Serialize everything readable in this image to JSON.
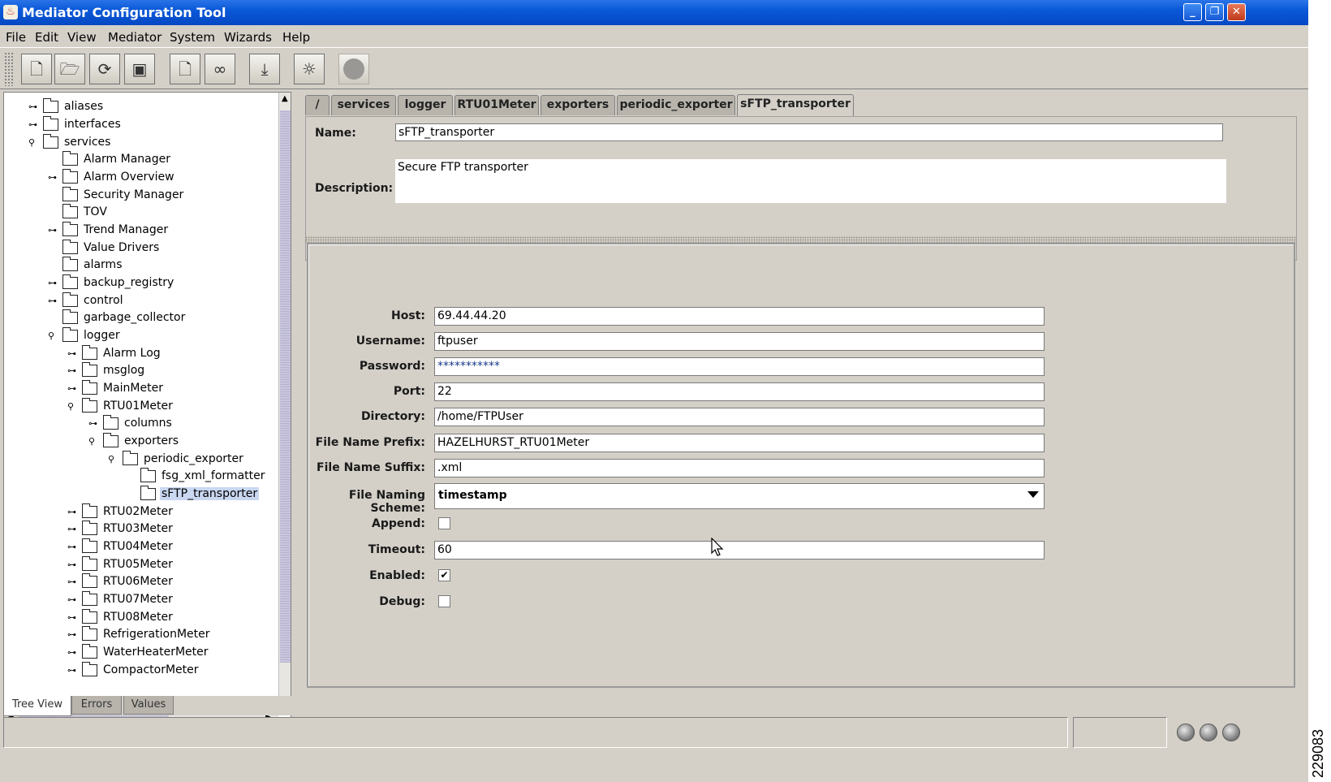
{
  "window": {
    "title": "Mediator Configuration Tool",
    "buttons": {
      "minimize": "_",
      "restore": "❐",
      "close": "✕"
    }
  },
  "menubar": [
    "File",
    "Edit",
    "View",
    "Mediator",
    "System",
    "Wizards",
    "Help"
  ],
  "toolbar": {
    "buttons": [
      "new-document-icon",
      "open-folder-icon",
      "refresh-icon",
      "save-icon",
      "new-page-icon",
      "binoculars-icon",
      "download-icon",
      "lightbulb-icon",
      "stop-icon"
    ]
  },
  "tree": {
    "nodes": [
      {
        "label": "aliases",
        "expanded": false
      },
      {
        "label": "interfaces",
        "expanded": false
      },
      {
        "label": "services",
        "expanded": true
      },
      {
        "label": "Alarm Manager"
      },
      {
        "label": "Alarm Overview",
        "expanded": false
      },
      {
        "label": "Security Manager"
      },
      {
        "label": "TOV"
      },
      {
        "label": "Trend Manager",
        "expanded": false
      },
      {
        "label": "Value Drivers"
      },
      {
        "label": "alarms"
      },
      {
        "label": "backup_registry",
        "expanded": false
      },
      {
        "label": "control",
        "expanded": false
      },
      {
        "label": "garbage_collector"
      },
      {
        "label": "logger",
        "expanded": true
      },
      {
        "label": "Alarm Log",
        "expanded": false
      },
      {
        "label": "msglog",
        "expanded": false
      },
      {
        "label": "MainMeter",
        "expanded": false
      },
      {
        "label": "RTU01Meter",
        "expanded": true
      },
      {
        "label": "columns",
        "expanded": false
      },
      {
        "label": "exporters",
        "expanded": true
      },
      {
        "label": "periodic_exporter",
        "expanded": true
      },
      {
        "label": "fsg_xml_formatter"
      },
      {
        "label": "sFTP_transporter",
        "selected": true
      },
      {
        "label": "RTU02Meter",
        "expanded": false
      },
      {
        "label": "RTU03Meter",
        "expanded": false
      },
      {
        "label": "RTU04Meter",
        "expanded": false
      },
      {
        "label": "RTU05Meter",
        "expanded": false
      },
      {
        "label": "RTU06Meter",
        "expanded": false
      },
      {
        "label": "RTU07Meter",
        "expanded": false
      },
      {
        "label": "RTU08Meter",
        "expanded": false
      },
      {
        "label": "RefrigerationMeter",
        "expanded": false
      },
      {
        "label": "WaterHeaterMeter",
        "expanded": false
      },
      {
        "label": "CompactorMeter",
        "expanded": false
      }
    ]
  },
  "tabs": [
    "/",
    "services",
    "logger",
    "RTU01Meter",
    "exporters",
    "periodic_exporter",
    "sFTP_transporter"
  ],
  "active_tab": "sFTP_transporter",
  "header_form": {
    "name_label": "Name:",
    "name_value": "sFTP_transporter",
    "description_label": "Description:",
    "description_value": "Secure FTP transporter"
  },
  "settings": {
    "host_label": "Host:",
    "host_value": "69.44.44.20",
    "username_label": "Username:",
    "username_value": "ftpuser",
    "password_label": "Password:",
    "password_value": "***********",
    "port_label": "Port:",
    "port_value": "22",
    "directory_label": "Directory:",
    "directory_value": "/home/FTPUser",
    "prefix_label": "File Name Prefix:",
    "prefix_value": "HAZELHURST_RTU01Meter",
    "suffix_label": "File Name Suffix:",
    "suffix_value": ".xml",
    "scheme_label": "File Naming Scheme:",
    "scheme_value": "timestamp",
    "append_label": "Append:",
    "append_checked": false,
    "timeout_label": "Timeout:",
    "timeout_value": "60",
    "enabled_label": "Enabled:",
    "enabled_checked": true,
    "debug_label": "Debug:",
    "debug_checked": false
  },
  "bottom_tabs": [
    "Tree View",
    "Errors",
    "Values"
  ],
  "active_bottom_tab": "Tree View",
  "side_code": "229083",
  "colors": {
    "titlebar": "#0a58d8",
    "window_bg": "#d4d0c8",
    "selection": "#c9d7f1"
  }
}
